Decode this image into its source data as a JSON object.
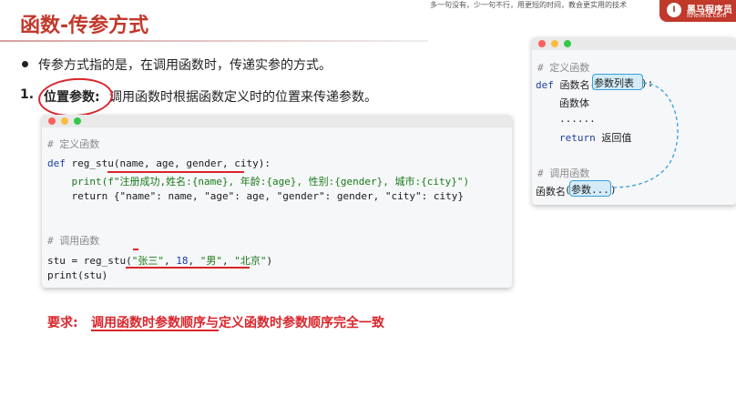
{
  "header": {
    "title": "函数-传参方式",
    "slogan": "多一句没有，少一句不行，用更短的时间，教会更实用的技术",
    "logo": {
      "mark": "I",
      "name": "黑马程序员",
      "url": "itheima.com"
    }
  },
  "content": {
    "bullet": "传参方式指的是，在调用函数时，传递实参的方式。",
    "point": {
      "number": "1.",
      "term": "位置参数:",
      "description": "调用函数时根据函数定义时的位置来传递参数。"
    },
    "code": {
      "comment_define": "# 定义函数",
      "def_kw": "def",
      "def_sig": " reg_stu(name, age, gender, city):",
      "print_line": "    print(f\"注册成功,姓名:{name}, 年龄:{age}, 性别:{gender}, 城市:{city}\")",
      "return_line": "    return {\"name\": name, \"age\": age, \"gender\": gender, \"city\": city}",
      "comment_call": "# 调用函数",
      "call_prefix": "stu = reg_stu(",
      "arg1": "\"张三\"",
      "sep1": ", ",
      "arg2": "18",
      "sep2": ", ",
      "arg3": "\"男\"",
      "sep3": ", ",
      "arg4": "\"北京\"",
      "call_suffix": ")",
      "print_stu": "print(stu)"
    },
    "requirement": {
      "label": "要求:",
      "text": "调用函数时参数顺序与定义函数时参数顺序完全一致"
    }
  },
  "side_panel": {
    "comment_define": "# 定义函数",
    "def_kw": "def",
    "func_name": "函数名",
    "param_list": "参数列表",
    "def_colon": "):",
    "paren_open": "(",
    "body": "函数体",
    "ellipsis": "......",
    "return_kw": "return",
    "return_val": "返回值",
    "comment_call": "# 调用函数",
    "call_func": "函数名",
    "call_args": "参数...",
    "call_close": ")"
  }
}
